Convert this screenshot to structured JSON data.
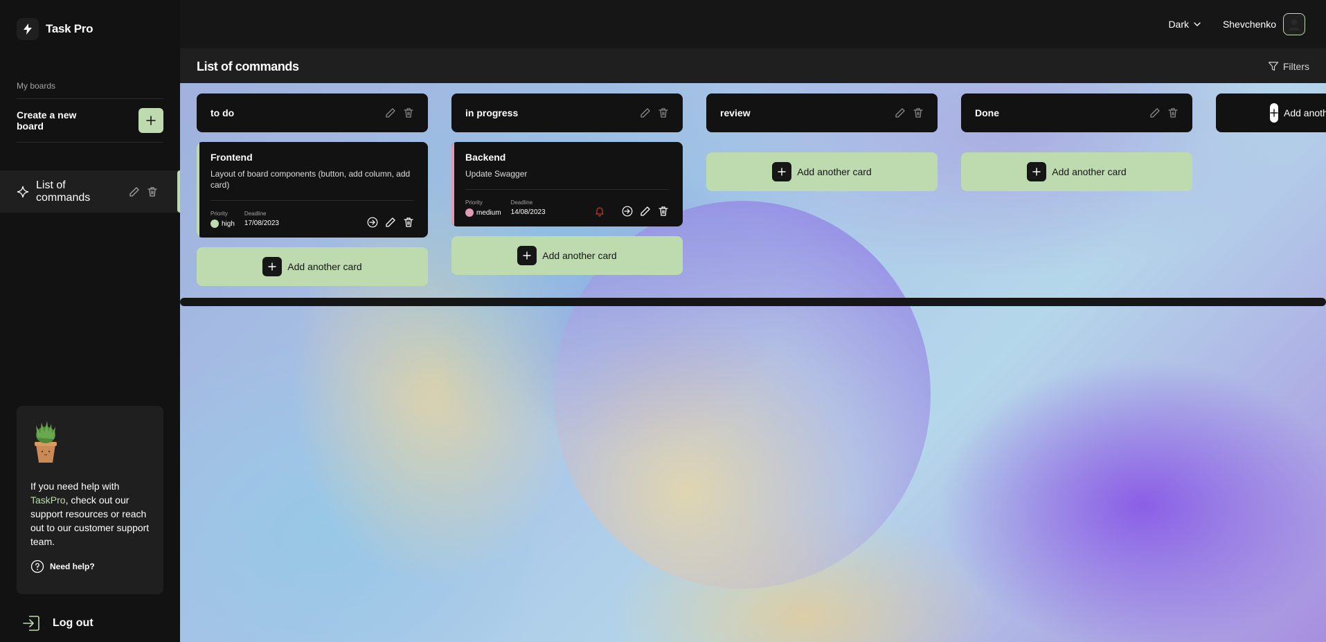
{
  "app": {
    "name": "Task Pro"
  },
  "sidebar": {
    "section_label": "My boards",
    "create_label": "Create a new board",
    "boards": [
      {
        "label": "List of commands"
      }
    ],
    "help": {
      "text_before": "If you need help with ",
      "text_accent": "TaskPro",
      "text_after": ", check out our support resources or reach out to our customer support team.",
      "link": "Need help?"
    },
    "logout": "Log out"
  },
  "header": {
    "theme": "Dark",
    "user_name": "Shevchenko"
  },
  "board": {
    "title": "List of commands",
    "filters": "Filters",
    "add_card_label": "Add another card",
    "add_column_label": "Add another column",
    "columns": [
      {
        "title": "to do",
        "cards": [
          {
            "title": "Frontend",
            "description": "Layout of board components (button, add column, add card)",
            "priority_label": "Priority",
            "priority": "high",
            "deadline_label": "Deadline",
            "deadline": "17/08/2023",
            "priority_color": "#bedbb0"
          }
        ]
      },
      {
        "title": "in progress",
        "cards": [
          {
            "title": "Backend",
            "description": "Update Swagger",
            "priority_label": "Priority",
            "priority": "medium",
            "deadline_label": "Deadline",
            "deadline": "14/08/2023",
            "priority_color": "#e09cb5"
          }
        ]
      },
      {
        "title": "review",
        "cards": []
      },
      {
        "title": "Done",
        "cards": []
      }
    ]
  },
  "colors": {
    "accent": "#bedbb0",
    "bg": "#161616",
    "panel": "#121212",
    "bell": "#c0392b"
  }
}
